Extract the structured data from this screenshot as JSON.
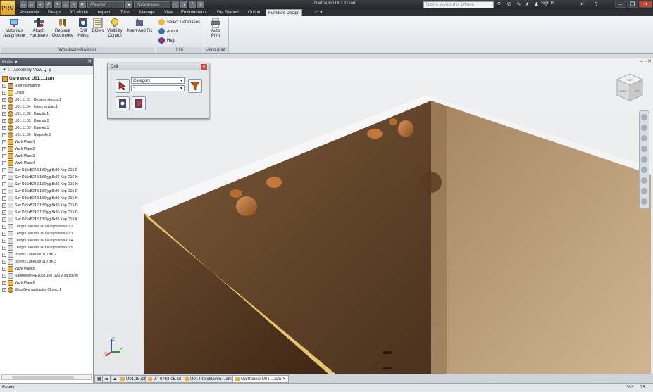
{
  "titlebar": {
    "app_button": "PRO",
    "material_placeholder": "Material",
    "appearance_placeholder": "Appearance",
    "document_title": "Gartraukio U01.11.iam",
    "search_placeholder": "Type a keyword or phrase",
    "sign_in": "Sign In"
  },
  "ribbon_tabs": [
    "Assemble",
    "Design",
    "3D Model",
    "Inspect",
    "Tools",
    "Manage",
    "View",
    "Environments",
    "Get Started",
    "Online",
    "Furniture Design"
  ],
  "ribbon": {
    "woodwork_buttons": [
      {
        "label1": "Materials",
        "label2": "Assignment"
      },
      {
        "label1": "Attach",
        "label2": "Hardware"
      },
      {
        "label1": "Replace",
        "label2": "Occurrence"
      },
      {
        "label1": "Drill",
        "label2": "Holes"
      },
      {
        "label1": "BOMs",
        "label2": ""
      },
      {
        "label1": "Visibility",
        "label2": "Control"
      },
      {
        "label1": "Insert And Fix",
        "label2": ""
      }
    ],
    "woodwork_group": "Woodwork4Inventor",
    "info_items": [
      "Select Databases",
      "About",
      "Help"
    ],
    "info_group": "Info",
    "auto_print": {
      "label1": "Auto",
      "label2": "Print"
    },
    "auto_print_group": "Auto print"
  },
  "browser": {
    "header": "Model",
    "view_label": "Assembly View",
    "root": "Gartraukio U01.11.iam",
    "items": [
      {
        "label": "Representations",
        "icon": "rep"
      },
      {
        "label": "Origin",
        "icon": "folder"
      },
      {
        "label": "U01.11.01 : Desinys skydas:1",
        "icon": "part"
      },
      {
        "label": "U01.11.04 : kairys skydas:1",
        "icon": "part"
      },
      {
        "label": "U01.11.00 : Dangtis:1",
        "icon": "part"
      },
      {
        "label": "U01.11.02 : Dugnas:1",
        "icon": "part"
      },
      {
        "label": "U01.11.03 : Durelės:1",
        "icon": "part"
      },
      {
        "label": "U01.11.06 : Nugarelė:1",
        "icon": "part"
      },
      {
        "label": "Work Plane1",
        "icon": "plane"
      },
      {
        "label": "Work Plane2",
        "icon": "plane"
      },
      {
        "label": "Work Plane3",
        "icon": "plane"
      },
      {
        "label": "Work Plane4",
        "icon": "plane"
      },
      {
        "label": "Sav D15xB24 S18 Dyg 8x30 Kep D15-D",
        "icon": "sav"
      },
      {
        "label": "Sav D15xB24 S18 Dyg 8x30 Kep D15-K:",
        "icon": "sav"
      },
      {
        "label": "Sav D15xB24 S18 Dyg 8x30 Kep D15-K:",
        "icon": "sav"
      },
      {
        "label": "Sav D15xB24 S18 Dyg 8x30 Kep D15-D",
        "icon": "sav"
      },
      {
        "label": "Sav D15xB24 S18 Dyg 8x30 Kep D15-K:",
        "icon": "sav"
      },
      {
        "label": "Sav D15xB24 S18 Dyg 8x30 Kep D15-D",
        "icon": "sav"
      },
      {
        "label": "Sav D15xB24 S18 Dyg 8x30 Kep D15-D",
        "icon": "sav"
      },
      {
        "label": "Sav D15xB24 S18 Dyg 8x30 Kep D15-K:",
        "icon": "sav"
      },
      {
        "label": "Lentynu laikiklis su kiaurymemis-01:2",
        "icon": "sav"
      },
      {
        "label": "Lentynu laikiklis su kiaurymemis-01:3",
        "icon": "sav"
      },
      {
        "label": "Lentynu laikiklis su kiaurymemis-01:4",
        "icon": "sav"
      },
      {
        "label": "Lentynu laikiklis su kiaurymemis-01:5",
        "icon": "sav"
      },
      {
        "label": "Isorinis Lankstas 110 BK:2",
        "icon": "sav"
      },
      {
        "label": "Isorinis Lankstas 110 BK:3",
        "icon": "sav"
      },
      {
        "label": "Work Plane5",
        "icon": "plane"
      },
      {
        "label": "Rankenele RE1008 160_220 2 varztai M",
        "icon": "sav"
      },
      {
        "label": "Work Plane6",
        "icon": "plane"
      },
      {
        "label": "Elica Gea gartraukis Closed:1",
        "icon": "part"
      }
    ]
  },
  "drill_dialog": {
    "title": "Drill",
    "category": "Category",
    "value": "*"
  },
  "viewcube": {
    "top": "TOP",
    "back": "BACK",
    "left": "LEFT"
  },
  "document_tabs": [
    "U01.15.ipt",
    "JP-0762-05.ipt",
    "U01 Projektavim...iam",
    "Gartraukio U01....iam"
  ],
  "status": {
    "text": "Ready",
    "n1": "303",
    "n2": "75"
  }
}
